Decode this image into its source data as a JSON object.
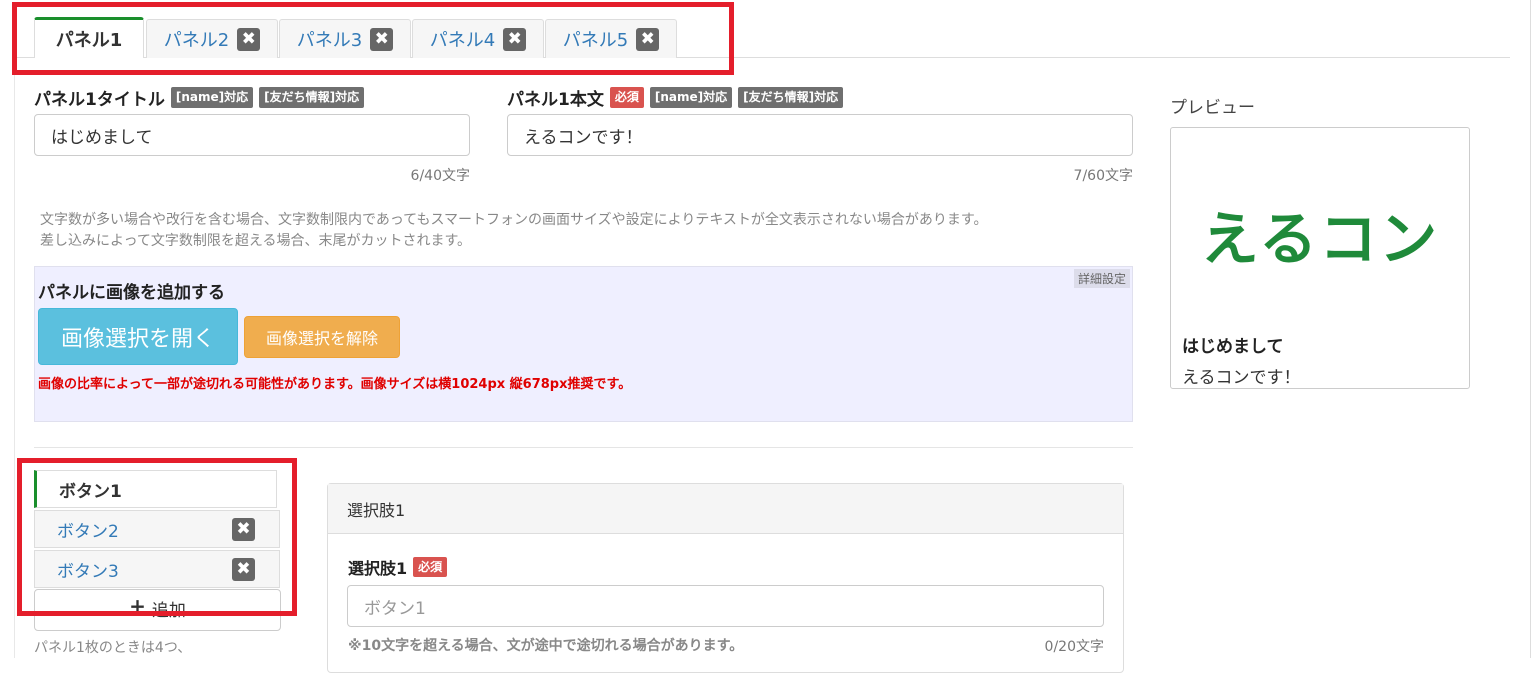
{
  "panel_tabs": [
    {
      "label": "パネル1",
      "active": true,
      "closable": false
    },
    {
      "label": "パネル2",
      "active": false,
      "closable": true
    },
    {
      "label": "パネル3",
      "active": false,
      "closable": true
    },
    {
      "label": "パネル4",
      "active": false,
      "closable": true
    },
    {
      "label": "パネル5",
      "active": false,
      "closable": true
    }
  ],
  "close_glyph": "✖",
  "title_field": {
    "label": "パネル1タイトル",
    "badges": [
      "[name]対応",
      "[友だち情報]対応"
    ],
    "value": "はじめまして",
    "counter": "6/40文字"
  },
  "body_field": {
    "label": "パネル1本文",
    "required_badge": "必須",
    "badges": [
      "[name]対応",
      "[友だち情報]対応"
    ],
    "value": "えるコンです！",
    "counter": "7/60文字"
  },
  "notes": {
    "line1": "文字数が多い場合や改行を含む場合、文字数制限内であってもスマートフォンの画面サイズや設定によりテキストが全文表示されない場合があります。",
    "line2": "差し込みによって文字数制限を超える場合、末尾がカットされます。"
  },
  "image_section": {
    "title": "パネルに画像を追加する",
    "detail_tag": "詳細設定",
    "open_button": "画像選択を開く",
    "clear_button": "画像選択を解除",
    "warning": "画像の比率によって一部が途切れる可能性があります。画像サイズは横1024px 縦678px推奨です。"
  },
  "preview": {
    "heading": "プレビュー",
    "logo_text": "えるコン",
    "title": "はじめまして",
    "body": "えるコンです！"
  },
  "button_tabs": [
    {
      "label": "ボタン1",
      "active": true
    },
    {
      "label": "ボタン2",
      "active": false
    },
    {
      "label": "ボタン3",
      "active": false
    }
  ],
  "add_button": {
    "icon": "+",
    "label": "追加"
  },
  "panel_limit_note": "パネル1枚のときは4つ、",
  "choice": {
    "header": "選択肢1",
    "label": "選択肢1",
    "required_badge": "必須",
    "placeholder": "ボタン1",
    "note": "※10文字を超える場合、文が途中で途切れる場合があります。",
    "counter": "0/20文字"
  },
  "colors": {
    "active_tab_accent": "#1a8f2c",
    "highlight_box": "#e41e2b",
    "open_button": "#5bc0de",
    "clear_button": "#f0ad4e",
    "required_badge": "#d9534f",
    "warning_text": "#e00000",
    "logo_green": "#1f8a3a"
  }
}
